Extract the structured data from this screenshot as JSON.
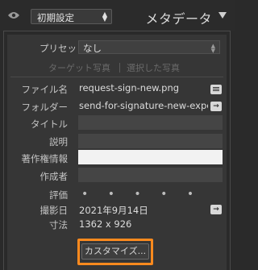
{
  "header": {
    "preset_select": "初期設定",
    "panel_title": "メタデータ"
  },
  "preset_row": {
    "label": "プリセット",
    "value": "なし"
  },
  "segments": {
    "target": "ターゲット写真",
    "selected": "選択した写真"
  },
  "fields": {
    "filename": {
      "label": "ファイル名",
      "value": "request-sign-new.png"
    },
    "folder": {
      "label": "フォルダー",
      "value": "send-for-signature-new-experi"
    },
    "title": {
      "label": "タイトル",
      "value": ""
    },
    "caption": {
      "label": "説明",
      "value": ""
    },
    "copyright": {
      "label": "著作権情報",
      "value": ""
    },
    "creator": {
      "label": "作成者",
      "value": ""
    },
    "rating": {
      "label": "評価",
      "value": "• • • • •"
    },
    "capture_date": {
      "label": "撮影日",
      "value": "2021年9月14日"
    },
    "dimensions": {
      "label": "寸法",
      "value": "1362 x 926"
    }
  },
  "customize_button": "カスタマイズ...",
  "colors": {
    "highlight": "#ff8a1e",
    "panel_bg": "#363636"
  }
}
